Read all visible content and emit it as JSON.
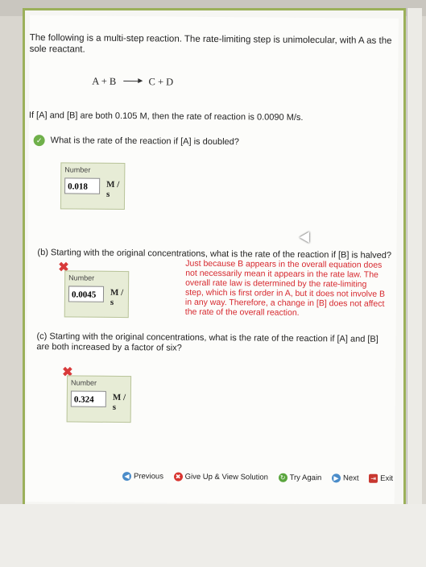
{
  "problem": {
    "intro": "The following is a multi-step reaction. The rate-limiting step is unimolecular, with A as the sole reactant.",
    "equation_left": "A + B",
    "equation_right": "C + D",
    "given": "If [A] and [B] are both 0.105 M, then the rate of reaction is 0.0090 M/s."
  },
  "part_a": {
    "question": "What is the rate of the reaction if [A] is doubled?",
    "label": "Number",
    "value": "0.018",
    "unit": "M / s"
  },
  "part_b": {
    "question": "(b) Starting with the original concentrations, what is the rate of the reaction if [B] is halved?",
    "label": "Number",
    "value": "0.0045",
    "unit": "M / s",
    "feedback": "Just because B appears in the overall equation does not necessarily mean it appears in the rate law. The overall rate law is determined by the rate-limiting step, which is first order in A, but it does not involve B in any way. Therefore, a change in [B] does not affect the rate of the overall reaction."
  },
  "part_c": {
    "question": "(c) Starting with the original concentrations, what is the rate of the reaction if [A] and [B] are both increased by a factor of six?",
    "label": "Number",
    "value": "0.324",
    "unit": "M / s"
  },
  "nav": {
    "previous": "Previous",
    "give_up": "Give Up & View Solution",
    "try_again": "Try Again",
    "next": "Next",
    "exit": "Exit"
  },
  "colors": {
    "accent": "#9bb05a",
    "error": "#d6282e",
    "correct": "#6fb04a"
  }
}
